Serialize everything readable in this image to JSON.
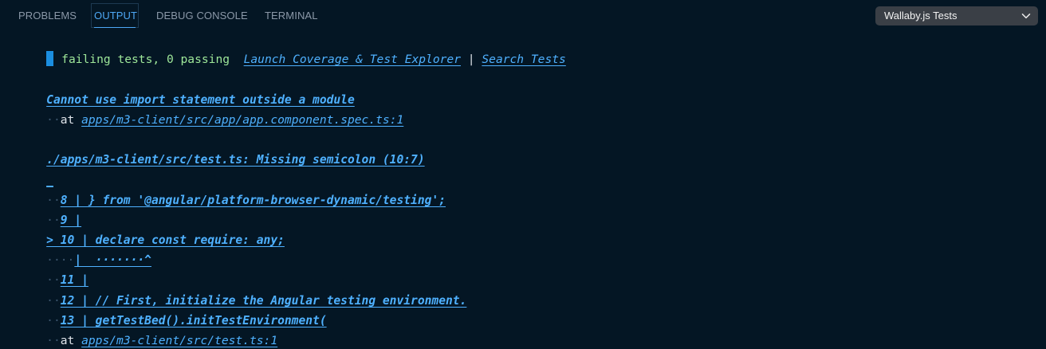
{
  "tabs": [
    {
      "label": "PROBLEMS"
    },
    {
      "label": "OUTPUT"
    },
    {
      "label": "DEBUG CONSOLE"
    },
    {
      "label": "TERMINAL"
    }
  ],
  "active_tab": "OUTPUT",
  "channel_select": {
    "value": "Wallaby.js Tests"
  },
  "colors": {
    "background": "#041624",
    "accent": "#4ea8f5",
    "link": "#4fb1ff",
    "passing_text": "#9fe89a"
  },
  "output": {
    "summary": "failing tests, 0 passing",
    "summary_links": [
      "Launch Coverage & Test Explorer",
      "Search Tests"
    ],
    "summary_separator": "|",
    "error1": {
      "message": "Cannot use import statement outside a module",
      "at_label": "at",
      "location": "apps/m3-client/src/app/app.component.spec.ts:1"
    },
    "error2": {
      "message": "./apps/m3-client/src/test.ts: Missing semicolon (10:7)",
      "blank_marker": "_",
      "code_lines": [
        {
          "prefix": "··",
          "text": "8 | } from '@angular/platform-browser-dynamic/testing';"
        },
        {
          "prefix": "··",
          "text": "9 |"
        },
        {
          "prefix": "",
          "text": "> 10 | declare const require: any;"
        },
        {
          "prefix": "····",
          "text": "|  ·······^"
        },
        {
          "prefix": "··",
          "text": "11 |"
        },
        {
          "prefix": "··",
          "text": "12 | // First, initialize the Angular testing environment."
        },
        {
          "prefix": "··",
          "text": "13 | getTestBed().initTestEnvironment("
        }
      ],
      "at_label": "at",
      "location": "apps/m3-client/src/test.ts:1"
    }
  }
}
